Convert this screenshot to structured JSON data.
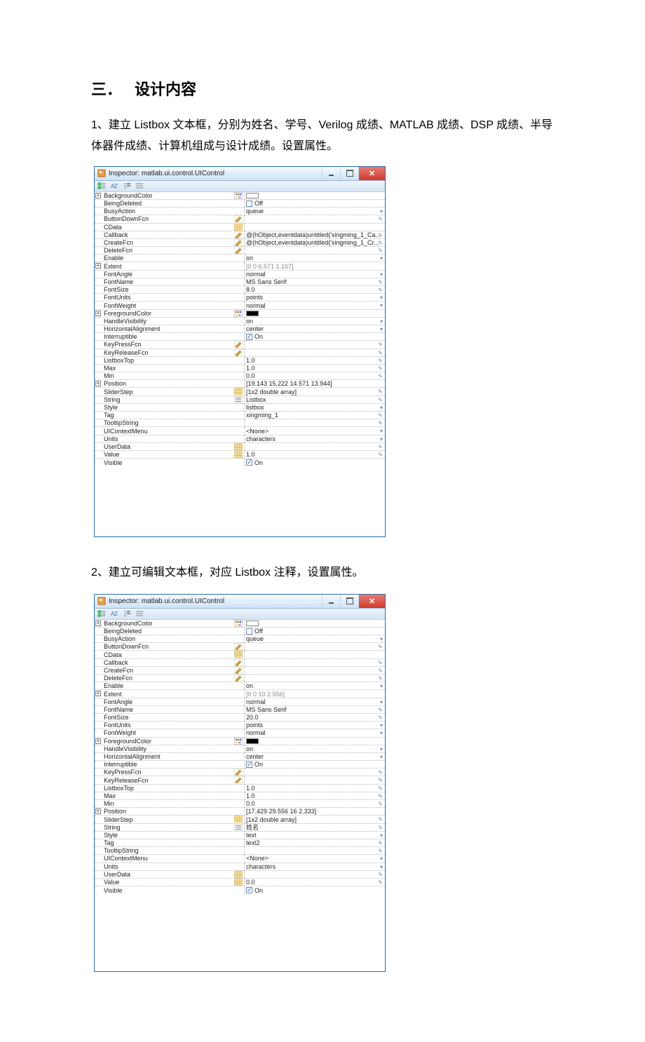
{
  "heading": {
    "num": "三．",
    "text": "设计内容"
  },
  "para1": "1、建立 Listbox 文本框，分别为姓名、学号、Verilog 成绩、MATLAB 成绩、DSP 成绩、半导体器件成绩、计算机组成与设计成绩。设置属性。",
  "para2": "2、建立可编辑文本框，对应 Listbox 注释，设置属性。",
  "inspector1": {
    "title": "Inspector: matlab.ui.control.UIControl",
    "props": [
      {
        "n": "BackgroundColor",
        "v": "",
        "exp": true,
        "li": "pal",
        "lv": "swatch-w",
        "rm": ""
      },
      {
        "n": "BeingDeleted",
        "v": "Off",
        "chk": "off"
      },
      {
        "n": "BusyAction",
        "v": "queue",
        "rm": "▾"
      },
      {
        "n": "ButtonDownFcn",
        "v": "",
        "li": "pencil",
        "rm": "✎"
      },
      {
        "n": "CData",
        "v": "",
        "li": "grid",
        "rm": ""
      },
      {
        "n": "Callback",
        "v": "@(hObject,eventdata)untitled('xingming_1_Ca...",
        "li": "pencil",
        "rm": "✎"
      },
      {
        "n": "CreateFcn",
        "v": "@(hObject,eventdata)untitled('xingming_1_Cr...",
        "li": "pencil",
        "rm": "✎"
      },
      {
        "n": "DeleteFcn",
        "v": "",
        "li": "pencil",
        "rm": "✎"
      },
      {
        "n": "Enable",
        "v": "on",
        "rm": "▾"
      },
      {
        "n": "Extent",
        "v": "[0 0 6.571 1.167]",
        "exp": true,
        "gray": true
      },
      {
        "n": "FontAngle",
        "v": "normal",
        "rm": "▾"
      },
      {
        "n": "FontName",
        "v": "MS Sans Serif",
        "rm": "✎"
      },
      {
        "n": "FontSize",
        "v": "8.0",
        "rm": "✎"
      },
      {
        "n": "FontUnits",
        "v": "points",
        "rm": "▾"
      },
      {
        "n": "FontWeight",
        "v": "normal",
        "rm": "▾"
      },
      {
        "n": "ForegroundColor",
        "v": "",
        "exp": true,
        "li": "pal",
        "lv": "swatch-b",
        "rm": ""
      },
      {
        "n": "HandleVisibility",
        "v": "on",
        "rm": "▾"
      },
      {
        "n": "HorizontalAlignment",
        "v": "center",
        "rm": "▾"
      },
      {
        "n": "Interruptible",
        "v": "On",
        "chk": "on"
      },
      {
        "n": "KeyPressFcn",
        "v": "",
        "li": "pencil",
        "rm": "✎"
      },
      {
        "n": "KeyReleaseFcn",
        "v": "",
        "li": "pencil",
        "rm": "✎"
      },
      {
        "n": "ListboxTop",
        "v": "1.0",
        "rm": "✎"
      },
      {
        "n": "Max",
        "v": "1.0",
        "rm": "✎"
      },
      {
        "n": "Min",
        "v": "0.0",
        "rm": "✎"
      },
      {
        "n": "Position",
        "v": "[19.143 15.222 14.571 13.944]",
        "exp": true
      },
      {
        "n": "SliderStep",
        "v": "[1x2  double array]",
        "li": "grid",
        "rm": "✎"
      },
      {
        "n": "String",
        "v": "Listbox",
        "li": "list",
        "rm": "✎"
      },
      {
        "n": "Style",
        "v": "listbox",
        "rm": "▾"
      },
      {
        "n": "Tag",
        "v": "xingming_1",
        "rm": "✎"
      },
      {
        "n": "TooltipString",
        "v": "",
        "rm": "✎"
      },
      {
        "n": "UIContextMenu",
        "v": "<None>",
        "rm": "▾"
      },
      {
        "n": "Units",
        "v": "characters",
        "rm": "▾"
      },
      {
        "n": "UserData",
        "v": "",
        "li": "grid",
        "rm": "✎"
      },
      {
        "n": "Value",
        "v": "1.0",
        "li": "grid",
        "rm": "✎"
      },
      {
        "n": "Visible",
        "v": "On",
        "chk": "on"
      }
    ]
  },
  "inspector2": {
    "title": "Inspector: matlab.ui.control.UIControl",
    "props": [
      {
        "n": "BackgroundColor",
        "v": "",
        "exp": true,
        "li": "pal",
        "lv": "swatch-w",
        "rm": ""
      },
      {
        "n": "BeingDeleted",
        "v": "Off",
        "chk": "off"
      },
      {
        "n": "BusyAction",
        "v": "queue",
        "rm": "▾"
      },
      {
        "n": "ButtonDownFcn",
        "v": "",
        "li": "pencil",
        "rm": "✎"
      },
      {
        "n": "CData",
        "v": "",
        "li": "grid",
        "rm": ""
      },
      {
        "n": "Callback",
        "v": "",
        "li": "pencil",
        "rm": "✎"
      },
      {
        "n": "CreateFcn",
        "v": "",
        "li": "pencil",
        "rm": "✎"
      },
      {
        "n": "DeleteFcn",
        "v": "",
        "li": "pencil",
        "rm": "✎"
      },
      {
        "n": "Enable",
        "v": "on",
        "rm": "▾"
      },
      {
        "n": "Extent",
        "v": "[0 0 10 2.556]",
        "exp": true,
        "gray": true
      },
      {
        "n": "FontAngle",
        "v": "normal",
        "rm": "▾"
      },
      {
        "n": "FontName",
        "v": "MS Sans Serif",
        "rm": "✎"
      },
      {
        "n": "FontSize",
        "v": "20.0",
        "rm": "✎"
      },
      {
        "n": "FontUnits",
        "v": "points",
        "rm": "▾"
      },
      {
        "n": "FontWeight",
        "v": "normal",
        "rm": "▾"
      },
      {
        "n": "ForegroundColor",
        "v": "",
        "exp": true,
        "li": "pal",
        "lv": "swatch-b",
        "rm": ""
      },
      {
        "n": "HandleVisibility",
        "v": "on",
        "rm": "▾"
      },
      {
        "n": "HorizontalAlignment",
        "v": "center",
        "rm": "▾"
      },
      {
        "n": "Interruptible",
        "v": "On",
        "chk": "on"
      },
      {
        "n": "KeyPressFcn",
        "v": "",
        "li": "pencil",
        "rm": "✎"
      },
      {
        "n": "KeyReleaseFcn",
        "v": "",
        "li": "pencil",
        "rm": "✎"
      },
      {
        "n": "ListboxTop",
        "v": "1.0",
        "rm": "✎"
      },
      {
        "n": "Max",
        "v": "1.0",
        "rm": "✎"
      },
      {
        "n": "Min",
        "v": "0.0",
        "rm": "✎"
      },
      {
        "n": "Position",
        "v": "[17.429 29.556 16 2.333]",
        "exp": true
      },
      {
        "n": "SliderStep",
        "v": "[1x2  double array]",
        "li": "grid",
        "rm": "✎"
      },
      {
        "n": "String",
        "v": "姓名",
        "li": "list",
        "rm": "✎"
      },
      {
        "n": "Style",
        "v": "text",
        "rm": "▾"
      },
      {
        "n": "Tag",
        "v": "text2",
        "rm": "✎"
      },
      {
        "n": "TooltipString",
        "v": "",
        "rm": "✎"
      },
      {
        "n": "UIContextMenu",
        "v": "<None>",
        "rm": "▾"
      },
      {
        "n": "Units",
        "v": "characters",
        "rm": "▾"
      },
      {
        "n": "UserData",
        "v": "",
        "li": "grid",
        "rm": "✎"
      },
      {
        "n": "Value",
        "v": "0.0",
        "li": "grid",
        "rm": "✎"
      },
      {
        "n": "Visible",
        "v": "On",
        "chk": "on"
      }
    ]
  }
}
